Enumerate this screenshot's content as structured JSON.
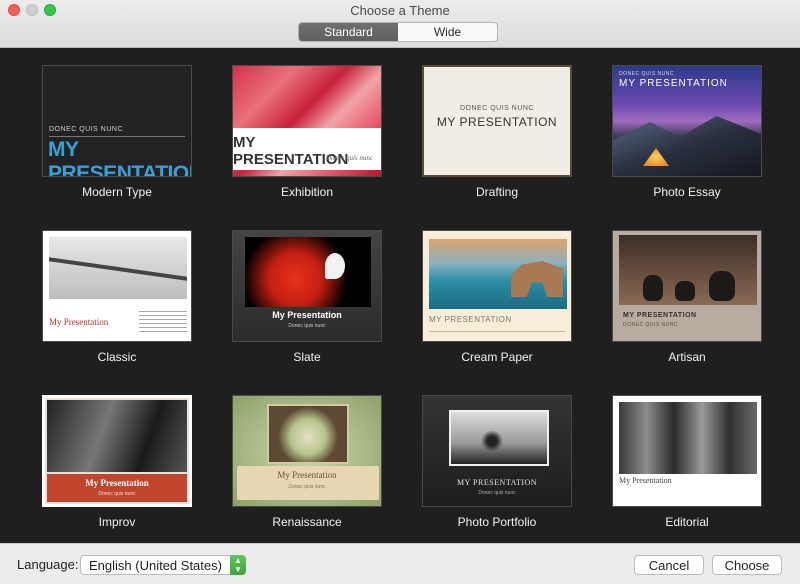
{
  "window": {
    "title": "Choose a Theme"
  },
  "segments": [
    "Standard",
    "Wide"
  ],
  "active_segment": "Standard",
  "themes": [
    {
      "label": "Modern Type",
      "small": "DONEC QUIS NUNC",
      "big": "MY PRESENTATION"
    },
    {
      "label": "Exhibition",
      "big": "MY PRESENTATION",
      "sub": "Donec quis nunc"
    },
    {
      "label": "Drafting",
      "small": "DONEC QUIS NUNC",
      "big": "MY PRESENTATION"
    },
    {
      "label": "Photo Essay",
      "small": "DONEC QUIS NUNC",
      "big": "MY PRESENTATION"
    },
    {
      "label": "Classic",
      "big": "My Presentation"
    },
    {
      "label": "Slate",
      "big": "My Presentation",
      "sub": "Donec quis nunc"
    },
    {
      "label": "Cream Paper",
      "big": "MY PRESENTATION"
    },
    {
      "label": "Artisan",
      "big": "MY PRESENTATION",
      "sub": "DONEC QUIS NUNC"
    },
    {
      "label": "Improv",
      "big": "My Presentation",
      "sub": "Donec quis nunc"
    },
    {
      "label": "Renaissance",
      "big": "My Presentation",
      "sub": "Donec quis nunc"
    },
    {
      "label": "Photo Portfolio",
      "big": "MY PRESENTATION",
      "sub": "Donec quis nunc"
    },
    {
      "label": "Editorial",
      "big": "My Presentation"
    }
  ],
  "footer": {
    "language_label": "Language:",
    "language_value": "English (United States)",
    "cancel_label": "Cancel",
    "choose_label": "Choose"
  }
}
